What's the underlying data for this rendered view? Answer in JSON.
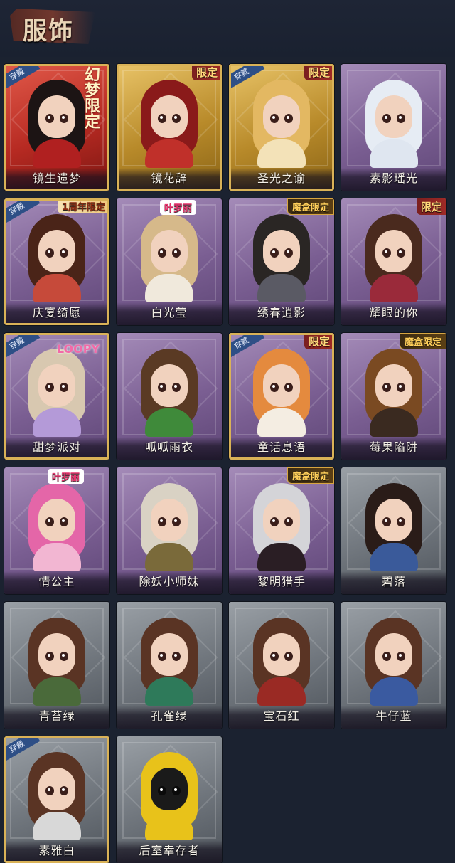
{
  "page": {
    "title": "服饰"
  },
  "costumes": [
    {
      "name": "镜生遗梦",
      "wearing": true,
      "tag": "幻梦限定",
      "tag_style": "vertical",
      "theme": "red",
      "hair": "#1c1414",
      "outfit": "#b02020"
    },
    {
      "name": "镜花辞",
      "wearing": false,
      "tag": "限定",
      "tag_style": "gold",
      "theme": "gold",
      "hair": "#8a1a1a",
      "outfit": "#c0302a"
    },
    {
      "name": "圣光之谕",
      "wearing": true,
      "tag": "限定",
      "tag_style": "gold",
      "theme": "gold",
      "hair": "#e3b862",
      "outfit": "#f3e2b8"
    },
    {
      "name": "素影瑶光",
      "wearing": false,
      "tag": "",
      "tag_style": "",
      "theme": "purple",
      "hair": "#e6ecf4",
      "outfit": "#dfe6f0"
    },
    {
      "name": "庆宴绮愿",
      "wearing": true,
      "tag": "1周年限定",
      "tag_style": "anniv",
      "theme": "purple",
      "hair": "#4a2418",
      "outfit": "#c64a3a"
    },
    {
      "name": "白光莹",
      "wearing": false,
      "tag": "叶罗丽",
      "tag_style": "pink",
      "theme": "purple",
      "hair": "#d6b98a",
      "outfit": "#f0e9dc"
    },
    {
      "name": "绣春逍影",
      "wearing": false,
      "tag": "魔盒限定",
      "tag_style": "magic",
      "theme": "purple",
      "hair": "#2a2624",
      "outfit": "#5a5a64"
    },
    {
      "name": "耀眼的你",
      "wearing": false,
      "tag": "限定",
      "tag_style": "gold",
      "theme": "purple",
      "hair": "#4a2a1e",
      "outfit": "#9a2a3a"
    },
    {
      "name": "甜梦派对",
      "wearing": true,
      "tag": "LOOPY",
      "tag_style": "loopy",
      "theme": "purple",
      "hair": "#d8c8b0",
      "outfit": "#b49ad8"
    },
    {
      "name": "呱呱雨衣",
      "wearing": false,
      "tag": "",
      "tag_style": "",
      "theme": "purple",
      "hair": "#5a3a24",
      "outfit": "#3f8a3a"
    },
    {
      "name": "童话息语",
      "wearing": true,
      "tag": "限定",
      "tag_style": "gold",
      "theme": "purple",
      "hair": "#e48a3e",
      "outfit": "#f4ede2"
    },
    {
      "name": "莓果陷阱",
      "wearing": false,
      "tag": "魔盒限定",
      "tag_style": "magic",
      "theme": "purple",
      "hair": "#7a4a22",
      "outfit": "#3a2a20"
    },
    {
      "name": "情公主",
      "wearing": false,
      "tag": "叶罗丽",
      "tag_style": "pink",
      "theme": "purple",
      "hair": "#e466a8",
      "outfit": "#f2b6d2"
    },
    {
      "name": "除妖小师妹",
      "wearing": false,
      "tag": "",
      "tag_style": "",
      "theme": "purple",
      "hair": "#d9d2c4",
      "outfit": "#7a6a3a"
    },
    {
      "name": "黎明猎手",
      "wearing": false,
      "tag": "魔盒限定",
      "tag_style": "magic",
      "theme": "purple",
      "hair": "#d4d4d8",
      "outfit": "#2a1e24"
    },
    {
      "name": "碧落",
      "wearing": false,
      "tag": "",
      "tag_style": "",
      "theme": "gray",
      "hair": "#2a1c18",
      "outfit": "#3a5a9a"
    },
    {
      "name": "青苔绿",
      "wearing": false,
      "tag": "",
      "tag_style": "",
      "theme": "gray",
      "hair": "#5a3424",
      "outfit": "#4a6a3a"
    },
    {
      "name": "孔雀绿",
      "wearing": false,
      "tag": "",
      "tag_style": "",
      "theme": "gray",
      "hair": "#5a3424",
      "outfit": "#2e7a5a"
    },
    {
      "name": "宝石红",
      "wearing": false,
      "tag": "",
      "tag_style": "",
      "theme": "gray",
      "hair": "#5a3424",
      "outfit": "#9a2a24"
    },
    {
      "name": "牛仔蓝",
      "wearing": false,
      "tag": "",
      "tag_style": "",
      "theme": "gray",
      "hair": "#5a3424",
      "outfit": "#3a5aa0"
    },
    {
      "name": "素雅白",
      "wearing": true,
      "tag": "",
      "tag_style": "",
      "theme": "gray",
      "hair": "#5a3424",
      "outfit": "#d8d8d8"
    },
    {
      "name": "后室幸存者",
      "wearing": false,
      "tag": "",
      "tag_style": "",
      "theme": "gray",
      "hair": "#e8c21a",
      "outfit": "#e8c21a"
    }
  ],
  "wear_label": "穿戴",
  "colors": {
    "background": "#1b2230",
    "title": "#e9d5b7",
    "wear_badge": "#2e4f86"
  }
}
